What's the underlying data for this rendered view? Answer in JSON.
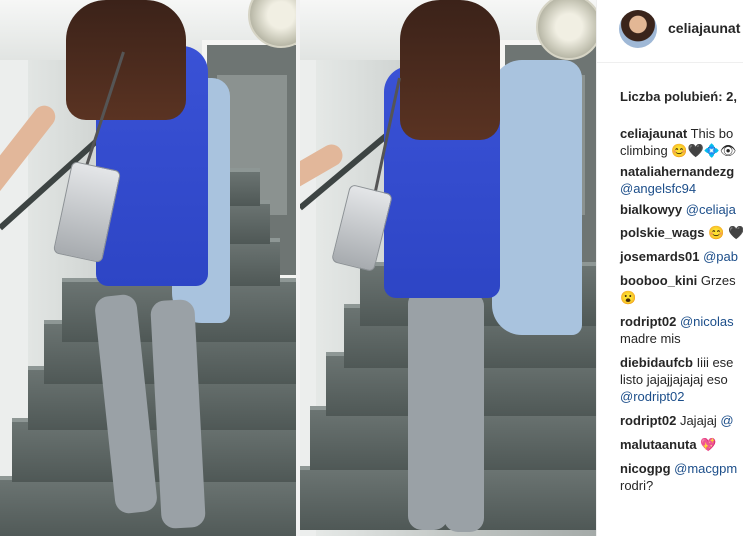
{
  "header": {
    "username": "celiajaunat"
  },
  "likes": {
    "label": "Liczba polubień: 2,"
  },
  "comments": [
    {
      "lines": [
        {
          "user": "celiajaunat",
          "text": " This bo"
        },
        {
          "text": "climbing 😊🖤💠👁"
        }
      ]
    },
    {
      "lines": [
        {
          "user": "nataliahernandezg"
        },
        {
          "mention": "@angelsfc94"
        }
      ]
    },
    {
      "lines": [
        {
          "user": "bialkowyy",
          "mention": " @celiaja"
        }
      ]
    },
    {
      "lines": [
        {
          "user": "polskie_wags",
          "text": " 😊 🖤"
        }
      ]
    },
    {
      "lines": [
        {
          "user": "josemards01",
          "mention": " @pab"
        }
      ]
    },
    {
      "lines": [
        {
          "user": "booboo_kini",
          "text": " Grzes"
        },
        {
          "text": "😮"
        }
      ]
    },
    {
      "lines": [
        {
          "user": "rodript02",
          "mention": " @nicolas"
        },
        {
          "text": "madre mis"
        }
      ]
    },
    {
      "lines": [
        {
          "user": "diebidaufcb",
          "text": " Iiii ese"
        },
        {
          "text": "listo jajajjajajaj eso"
        },
        {
          "mention": "@rodript02"
        }
      ]
    },
    {
      "lines": [
        {
          "user": "rodript02",
          "text": " Jajajaj",
          "mention": " @"
        }
      ]
    },
    {
      "lines": [
        {
          "user": "malutaanuta",
          "text": " 💖"
        }
      ]
    },
    {
      "lines": [
        {
          "user": "nicogpg",
          "mention": " @macgpm"
        },
        {
          "text": "rodri?"
        }
      ]
    }
  ]
}
